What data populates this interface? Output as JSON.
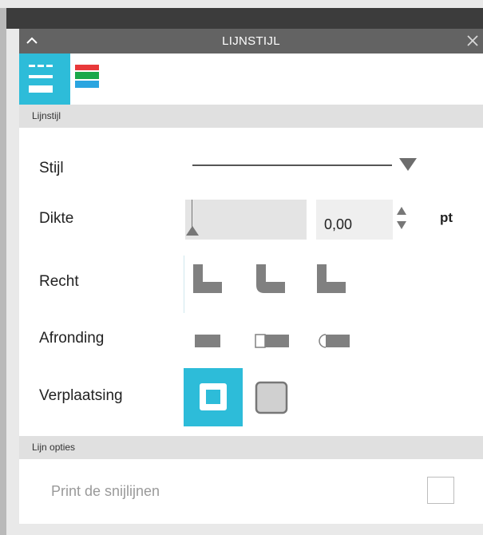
{
  "panel": {
    "title": "LIJNSTIJL",
    "collapse_icon": "chevron-up-icon",
    "close_icon": "close-icon"
  },
  "tabs": [
    {
      "name": "line-style-tab",
      "icon": "line-style-icon",
      "active": true
    },
    {
      "name": "line-color-tab",
      "icon": "color-bars-icon",
      "active": false
    }
  ],
  "sections": {
    "line_style": {
      "header": "Lijnstijl",
      "style_label": "Stijl",
      "thickness_label": "Dikte",
      "thickness_value": "0,00",
      "thickness_unit": "pt",
      "join_label": "Recht",
      "cap_label": "Afronding",
      "offset_label": "Verplaatsing"
    },
    "line_options": {
      "header": "Lijn opties",
      "print_cut_lines_label": "Print de snijlijnen",
      "print_cut_lines_checked": false
    }
  },
  "colors": {
    "accent": "#2dbcd9",
    "titlebar": "#636363",
    "section_header": "#e0e0e0",
    "icon_gray": "#808080"
  }
}
